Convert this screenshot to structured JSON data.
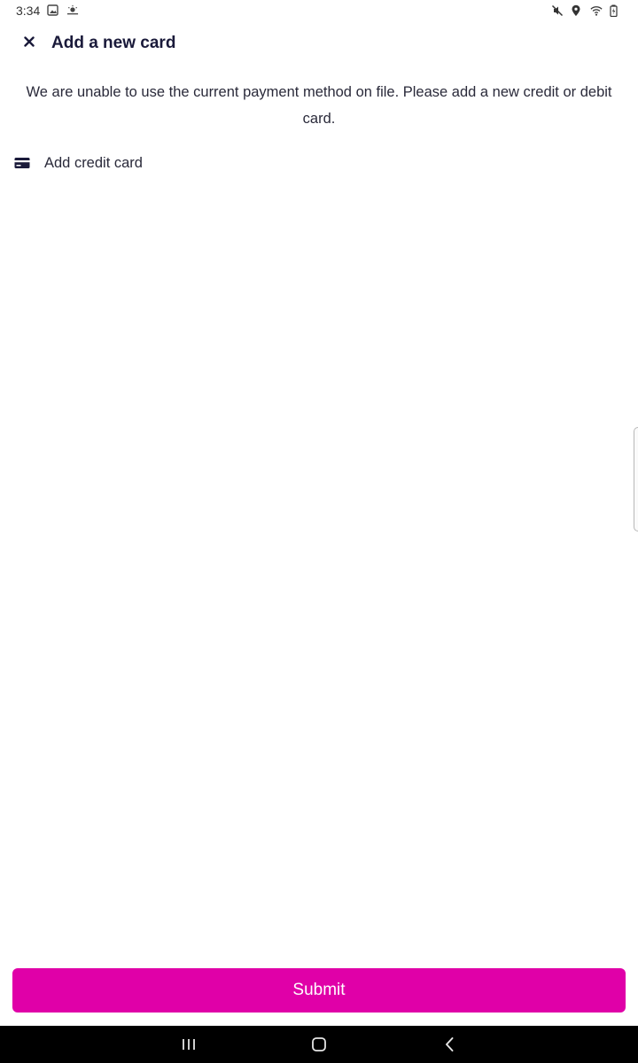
{
  "status_bar": {
    "time": "3:34",
    "left_icons": [
      "gallery-icon",
      "weather-icon"
    ],
    "right_icons": [
      "mute-icon",
      "location-icon",
      "wifi-icon",
      "battery-icon"
    ]
  },
  "header": {
    "title": "Add a new card",
    "close_icon": "close-icon"
  },
  "message": "We are unable to use the current payment method on file. Please add a new credit or debit card.",
  "add_card": {
    "label": "Add credit card",
    "icon": "credit-card-icon"
  },
  "submit": {
    "label": "Submit",
    "color": "#e000a8"
  },
  "nav_bar": {
    "buttons": [
      "recents-icon",
      "home-icon",
      "back-icon"
    ]
  }
}
